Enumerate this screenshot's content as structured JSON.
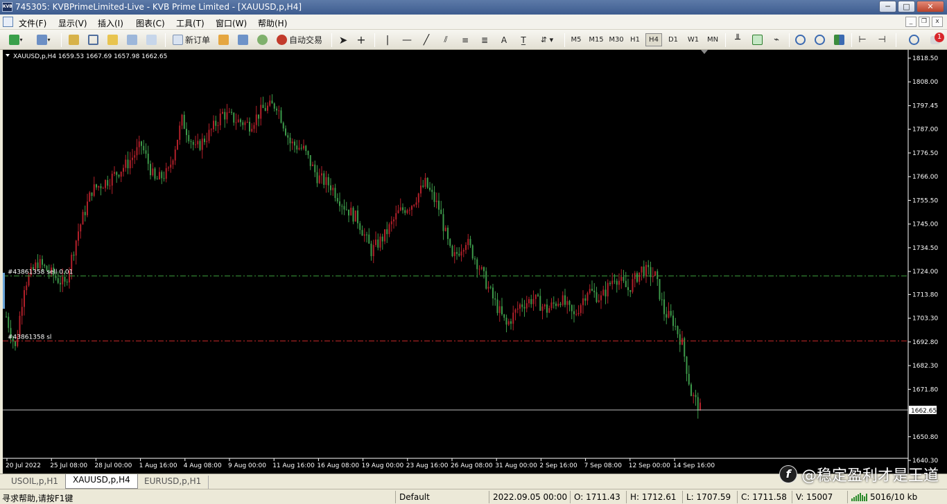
{
  "window": {
    "title": "745305: KVBPrimeLimited-Live - KVB Prime Limited - [XAUUSD,p,H4]",
    "app_icon_text": "KVB",
    "buttons": {
      "minimize": "─",
      "maximize": "□",
      "close": "✕"
    }
  },
  "menu": [
    "文件(F)",
    "显示(V)",
    "插入(I)",
    "图表(C)",
    "工具(T)",
    "窗口(W)",
    "帮助(H)"
  ],
  "mdi_buttons": {
    "minimize": "_",
    "restore": "❐",
    "close": "x"
  },
  "toolbar": {
    "new_order": "新订单",
    "auto_trading": "自动交易",
    "text_tool": "A",
    "timeframes": [
      "M5",
      "M15",
      "M30",
      "H1",
      "H4",
      "D1",
      "W1",
      "MN"
    ],
    "active_timeframe": "H4",
    "notification_count": "1"
  },
  "chart": {
    "header": "XAUUSD,p,H4  1659.53 1667.69 1657.98 1662.65",
    "order_line_sell": "#43861358 sell 0.01",
    "order_line_sl": "#43861358 sl",
    "current_price_label": "1662.65",
    "colors": {
      "up": "#b3202a",
      "down": "#3d9a4a",
      "sell_line": "#3c9e3c",
      "sl_line": "#c42828",
      "price_line": "#c0c0c0",
      "background": "#000000",
      "axis_text": "#ffffff"
    }
  },
  "chart_data": {
    "type": "candlestick",
    "symbol": "XAUUSD,p",
    "timeframe": "H4",
    "ylim": [
      1640.0,
      1818.5
    ],
    "y_ticks": [
      1818.5,
      1808.0,
      1797.45,
      1787.0,
      1776.5,
      1766.0,
      1755.5,
      1745.0,
      1734.5,
      1724.0,
      1713.8,
      1703.3,
      1692.8,
      1682.3,
      1671.8,
      1650.8,
      1640.3
    ],
    "x_ticks": [
      "20 Jul 2022",
      "25 Jul 08:00",
      "28 Jul 00:00",
      "1 Aug 16:00",
      "4 Aug 08:00",
      "9 Aug 00:00",
      "11 Aug 16:00",
      "16 Aug 08:00",
      "19 Aug 00:00",
      "23 Aug 16:00",
      "26 Aug 08:00",
      "31 Aug 00:00",
      "2 Sep 16:00",
      "7 Sep 08:00",
      "12 Sep 00:00",
      "14 Sep 16:00"
    ],
    "order_levels": {
      "sell_entry": 1722.0,
      "stop_loss": 1693.2
    },
    "last_price": 1662.65,
    "close_path": [
      {
        "i": 0,
        "v": 1704
      },
      {
        "i": 4,
        "v": 1690
      },
      {
        "i": 8,
        "v": 1718
      },
      {
        "i": 14,
        "v": 1728
      },
      {
        "i": 20,
        "v": 1723
      },
      {
        "i": 26,
        "v": 1718
      },
      {
        "i": 32,
        "v": 1742
      },
      {
        "i": 38,
        "v": 1760
      },
      {
        "i": 46,
        "v": 1765
      },
      {
        "i": 54,
        "v": 1772
      },
      {
        "i": 60,
        "v": 1780
      },
      {
        "i": 66,
        "v": 1764
      },
      {
        "i": 72,
        "v": 1768
      },
      {
        "i": 78,
        "v": 1791
      },
      {
        "i": 84,
        "v": 1778
      },
      {
        "i": 90,
        "v": 1785
      },
      {
        "i": 96,
        "v": 1794
      },
      {
        "i": 102,
        "v": 1791
      },
      {
        "i": 108,
        "v": 1789
      },
      {
        "i": 114,
        "v": 1796
      },
      {
        "i": 120,
        "v": 1798
      },
      {
        "i": 126,
        "v": 1781
      },
      {
        "i": 132,
        "v": 1778
      },
      {
        "i": 138,
        "v": 1766
      },
      {
        "i": 144,
        "v": 1762
      },
      {
        "i": 150,
        "v": 1753
      },
      {
        "i": 156,
        "v": 1747
      },
      {
        "i": 162,
        "v": 1733
      },
      {
        "i": 168,
        "v": 1740
      },
      {
        "i": 174,
        "v": 1750
      },
      {
        "i": 180,
        "v": 1754
      },
      {
        "i": 186,
        "v": 1763
      },
      {
        "i": 192,
        "v": 1752
      },
      {
        "i": 198,
        "v": 1729
      },
      {
        "i": 204,
        "v": 1738
      },
      {
        "i": 210,
        "v": 1726
      },
      {
        "i": 216,
        "v": 1712
      },
      {
        "i": 222,
        "v": 1700
      },
      {
        "i": 228,
        "v": 1709
      },
      {
        "i": 234,
        "v": 1712
      },
      {
        "i": 240,
        "v": 1707
      },
      {
        "i": 246,
        "v": 1712
      },
      {
        "i": 252,
        "v": 1704
      },
      {
        "i": 258,
        "v": 1716
      },
      {
        "i": 264,
        "v": 1712
      },
      {
        "i": 270,
        "v": 1722
      },
      {
        "i": 276,
        "v": 1716
      },
      {
        "i": 282,
        "v": 1725
      },
      {
        "i": 288,
        "v": 1722
      },
      {
        "i": 292,
        "v": 1706
      },
      {
        "i": 296,
        "v": 1702
      },
      {
        "i": 300,
        "v": 1692
      },
      {
        "i": 304,
        "v": 1670
      },
      {
        "i": 308,
        "v": 1663
      }
    ]
  },
  "tabs": [
    "USOIL,p,H1",
    "XAUUSD,p,H4",
    "EURUSD,p,H1"
  ],
  "active_tab": "XAUUSD,p,H4",
  "watermark": {
    "logo": "f",
    "text": "@稳定盈利才是王道"
  },
  "status": {
    "help": "寻求帮助,请按F1键",
    "profile": "Default",
    "datetime": "2022.09.05 00:00",
    "open": "O: 1711.43",
    "high": "H: 1712.61",
    "low": "L: 1707.59",
    "close": "C: 1711.58",
    "volume": "V: 15007",
    "traffic": "5016/10 kb"
  }
}
